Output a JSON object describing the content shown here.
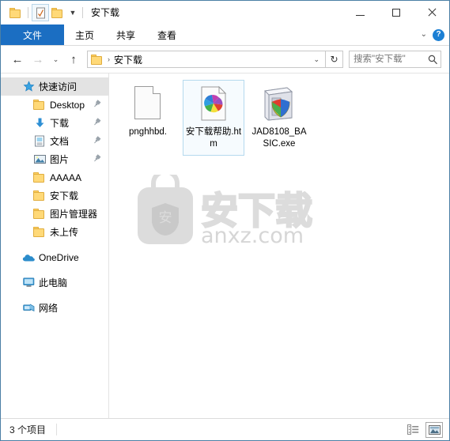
{
  "window": {
    "title": "安下载",
    "quick_access_toolbar": [
      {
        "name": "folder-properties-icon",
        "label": "folder"
      },
      {
        "name": "properties-checklist-icon",
        "label": "properties"
      },
      {
        "name": "new-folder-icon",
        "label": "new folder"
      },
      {
        "name": "customize-caret-icon",
        "label": "▾"
      }
    ],
    "controls": {
      "minimize": "minimize",
      "maximize": "maximize",
      "close": "close"
    }
  },
  "ribbon": {
    "tabs": [
      {
        "label": "文件",
        "active": true
      },
      {
        "label": "主页",
        "active": false
      },
      {
        "label": "共享",
        "active": false
      },
      {
        "label": "查看",
        "active": false
      }
    ],
    "expand_caret": "⌄",
    "help_label": "?"
  },
  "address": {
    "back": "←",
    "forward": "→",
    "recent_caret": "⌄",
    "up": "↑",
    "path_separator": "›",
    "path_label": "安下载",
    "path_caret": "⌄",
    "refresh": "↻"
  },
  "search": {
    "placeholder": "搜索\"安下载\"",
    "value": "",
    "icon": "search-icon"
  },
  "sidebar": {
    "items": [
      {
        "label": "快速访问",
        "icon": "pin-star-icon",
        "level": 0,
        "selected": true,
        "pinned": false
      },
      {
        "label": "Desktop",
        "icon": "folder-icon",
        "level": 1,
        "selected": false,
        "pinned": true
      },
      {
        "label": "下载",
        "icon": "downloads-arrow-icon",
        "level": 1,
        "selected": false,
        "pinned": true
      },
      {
        "label": "文档",
        "icon": "documents-icon",
        "level": 1,
        "selected": false,
        "pinned": true
      },
      {
        "label": "图片",
        "icon": "pictures-icon",
        "level": 1,
        "selected": false,
        "pinned": true
      },
      {
        "label": "AAAAA",
        "icon": "folder-icon",
        "level": 1,
        "selected": false,
        "pinned": false
      },
      {
        "label": "安下载",
        "icon": "folder-icon",
        "level": 1,
        "selected": false,
        "pinned": false
      },
      {
        "label": "图片管理器",
        "icon": "folder-icon",
        "level": 1,
        "selected": false,
        "pinned": false
      },
      {
        "label": "未上传",
        "icon": "folder-icon",
        "level": 1,
        "selected": false,
        "pinned": false
      },
      {
        "label": "OneDrive",
        "icon": "onedrive-cloud-icon",
        "level": 0,
        "selected": false,
        "pinned": false
      },
      {
        "label": "此电脑",
        "icon": "this-pc-monitor-icon",
        "level": 0,
        "selected": false,
        "pinned": false
      },
      {
        "label": "网络",
        "icon": "network-icon",
        "level": 0,
        "selected": false,
        "pinned": false
      }
    ]
  },
  "files": [
    {
      "name": "pnghhbd.",
      "icon": "blank-document-icon",
      "selected": false
    },
    {
      "name": "安下载帮助.htm",
      "icon": "html-chrome-icon",
      "selected": true
    },
    {
      "name": "JAD8108_BASIC.exe",
      "icon": "installer-shield-icon",
      "selected": false
    }
  ],
  "watermark": {
    "text": "安下载",
    "url": "anxz.com"
  },
  "status": {
    "item_count": "3 个项目",
    "view_details_icon": "details-view-icon",
    "view_large_icons_icon": "large-icons-view-icon"
  },
  "colors": {
    "accent": "#1b6ec2",
    "window_border": "#4b7fa5",
    "selection_fill": "#f6fbfe",
    "selection_border": "#b5d9ee",
    "sidebar_selected": "#e3e3e3",
    "folder_yellow": "#ffd978"
  }
}
